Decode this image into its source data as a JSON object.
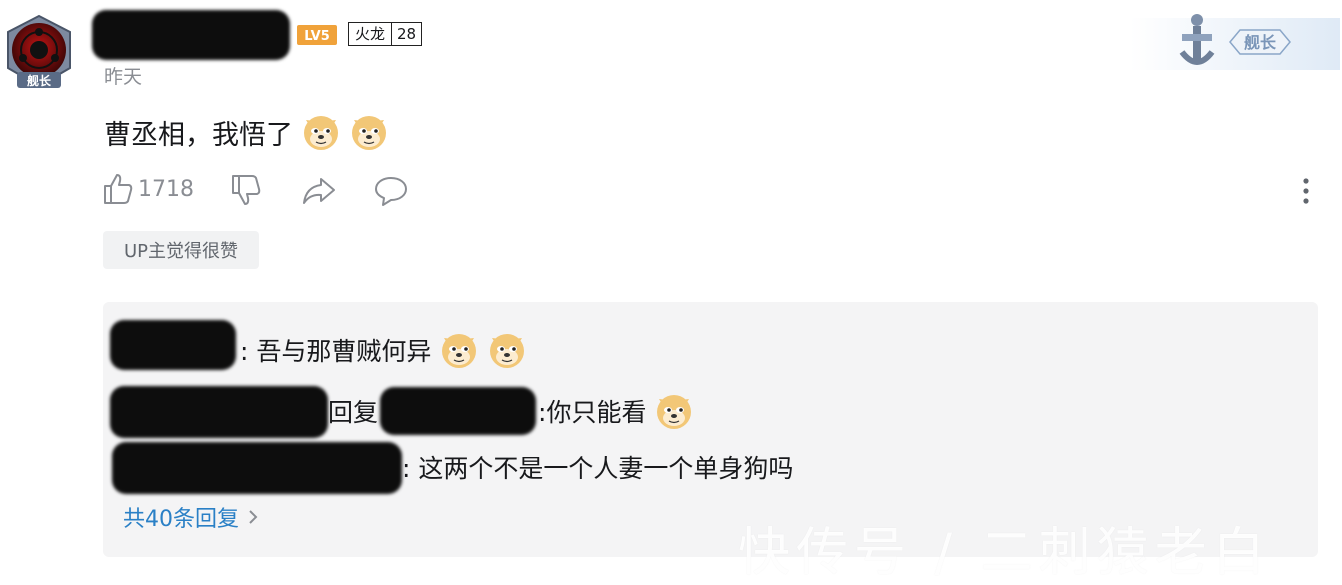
{
  "user": {
    "avatar_badge": "舰长",
    "level_badge": "LV5",
    "medal_name": "火龙",
    "medal_level": "28",
    "time": "昨天"
  },
  "comment": {
    "text": "曹丞相，我悟了",
    "emojis": [
      "doge-emoji",
      "doge-emoji"
    ],
    "like_count": "1718",
    "up_tag": "UP主觉得很赞"
  },
  "decoration": {
    "captain_label": "舰长"
  },
  "replies": [
    {
      "text": ": 吾与那曹贼何异",
      "emoji_count": 2
    },
    {
      "reply_word": "回复",
      "text": ":你只能看",
      "emoji_count": 1
    },
    {
      "text": ": 这两个不是一个人妻一个单身狗吗",
      "emoji_count": 0
    }
  ],
  "total_replies": "共40条回复",
  "watermark": "快传号 / 二刺猿老白",
  "colors": {
    "link": "#2a80c6",
    "muted": "#8a8d93",
    "reply_bg": "#f4f4f5"
  }
}
